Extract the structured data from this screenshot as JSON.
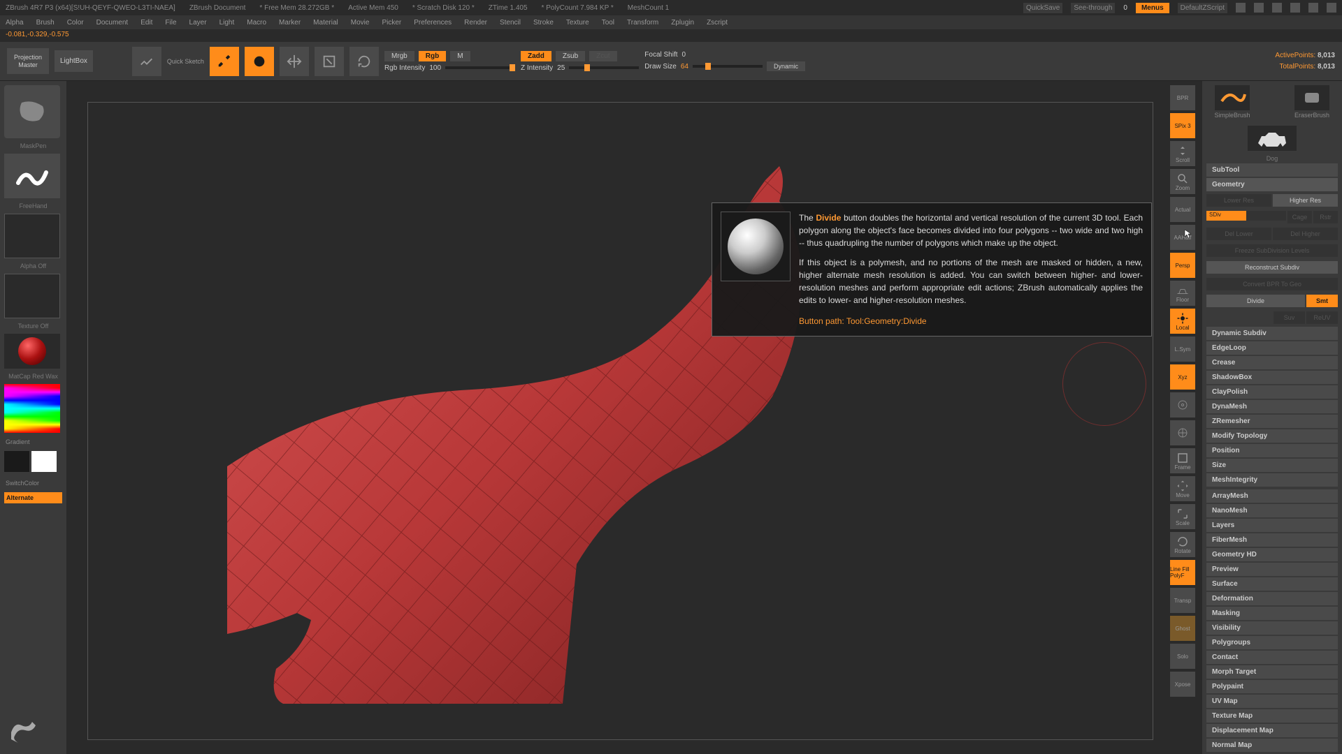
{
  "titlebar": {
    "app": "ZBrush 4R7 P3 (x64)[S!UH-QEYF-QWEO-L3TI-NAEA]",
    "doc": "ZBrush Document",
    "mem": "* Free Mem 28.272GB *",
    "actmem": "Active Mem 450",
    "scratch": "* Scratch Disk 120 *",
    "ztime": "ZTime 1.405",
    "poly": "* PolyCount 7.984 KP *",
    "mesh": "MeshCount 1",
    "quicksave": "QuickSave",
    "seethrough": "See-through",
    "seethrough_val": "0",
    "menus": "Menus",
    "script": "DefaultZScript"
  },
  "menubar": [
    "Alpha",
    "Brush",
    "Color",
    "Document",
    "Edit",
    "File",
    "Layer",
    "Light",
    "Macro",
    "Marker",
    "Material",
    "Movie",
    "Picker",
    "Preferences",
    "Render",
    "Stencil",
    "Stroke",
    "Texture",
    "Tool",
    "Transform",
    "Zplugin",
    "Zscript"
  ],
  "coords": "-0.081,-0.329,-0.575",
  "toolbar": {
    "projection": "Projection Master",
    "lightbox": "LightBox",
    "quicksketch": "Quick Sketch",
    "mrgb": "Mrgb",
    "rgb": "Rgb",
    "m": "M",
    "rgb_intensity_lbl": "Rgb Intensity",
    "rgb_intensity_val": "100",
    "zadd": "Zadd",
    "zsub": "Zsub",
    "zcut": "Zcut",
    "z_intensity_lbl": "Z Intensity",
    "z_intensity_val": "25",
    "focal_lbl": "Focal Shift",
    "focal_val": "0",
    "draw_lbl": "Draw Size",
    "draw_val": "64",
    "dynamic": "Dynamic",
    "active_pts": "ActivePoints:",
    "active_val": "8,013",
    "total_pts": "TotalPoints:",
    "total_val": "8,013"
  },
  "left": {
    "brush": "MaskPen",
    "stroke": "FreeHand",
    "alpha": "Alpha Off",
    "texture": "Texture Off",
    "material": "MatCap Red Wax",
    "gradient": "Gradient",
    "switch": "SwitchColor",
    "alternate": "Alternate"
  },
  "shelf": {
    "bpr": "BPR",
    "spix": "SPix 3",
    "scroll": "Scroll",
    "zoom": "Zoom",
    "actual": "Actual",
    "aahalf": "AAHalf",
    "persp": "Persp",
    "floor": "Floor",
    "local": "Local",
    "lsym": "L.Sym",
    "xyz": "Xyz",
    "frame": "Frame",
    "move": "Move",
    "scale": "Scale",
    "rotate": "Rotate",
    "polyf": "Line Fill PolyF",
    "transp": "Transp",
    "ghost": "Ghost",
    "solo": "Solo",
    "xpose": "Xpose"
  },
  "right": {
    "simple": "SimpleBrush",
    "eraser": "EraserBrush",
    "tool": "Dog",
    "subtool": "SubTool",
    "geometry": "Geometry",
    "lower": "Lower Res",
    "higher": "Higher Res",
    "sdiv": "SDiv",
    "cage": "Cage",
    "rstr": "Rstr",
    "del_lower": "Del Lower",
    "del_higher": "Del Higher",
    "freeze": "Freeze SubDivision Levels",
    "reconstruct": "Reconstruct Subdiv",
    "convert": "Convert BPR To Geo",
    "divide": "Divide",
    "smt": "Smt",
    "suv": "Suv",
    "reuv": "ReUV",
    "dynamic_subdiv": "Dynamic Subdiv",
    "edgeloop": "EdgeLoop",
    "crease": "Crease",
    "shadowbox": "ShadowBox",
    "claypolish": "ClayPolish",
    "dynamesh": "DynaMesh",
    "zremesher": "ZRemesher",
    "modify": "Modify Topology",
    "position": "Position",
    "size": "Size",
    "integrity": "MeshIntegrity",
    "sections": [
      "ArrayMesh",
      "NanoMesh",
      "Layers",
      "FiberMesh",
      "Geometry HD",
      "Preview",
      "Surface",
      "Deformation",
      "Masking",
      "Visibility",
      "Polygroups",
      "Contact",
      "Morph Target",
      "Polypaint",
      "UV Map",
      "Texture Map",
      "Displacement Map",
      "Normal Map"
    ]
  },
  "tooltip": {
    "p1a": "The ",
    "p1hl": "Divide",
    "p1b": " button doubles the horizontal and vertical resolution of the current 3D tool. Each polygon along the object's face becomes divided into four polygons -- two wide and two high -- thus quadrupling the number of polygons which make up the object.",
    "p2": "If this object is a polymesh, and no portions of the mesh are masked or hidden, a new, higher alternate mesh resolution is added. You can switch between higher- and lower-resolution meshes and perform appropriate edit actions; ZBrush automatically applies the edits to lower- and higher-resolution meshes.",
    "path_lbl": "Button path: ",
    "path_val": "Tool:Geometry:Divide"
  }
}
